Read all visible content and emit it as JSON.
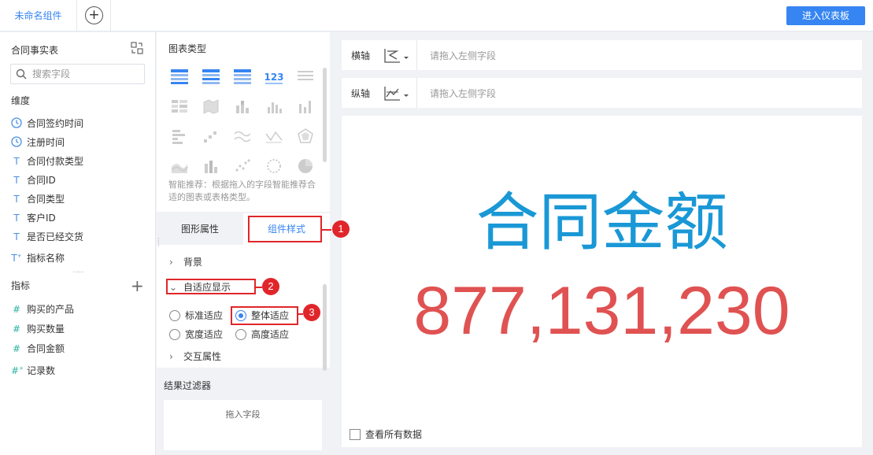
{
  "topbar": {
    "tab_label": "未命名组件",
    "add_tab_symbol": "+",
    "enter_dashboard_label": "进入仪表板"
  },
  "left_panel": {
    "title": "合同事实表",
    "search_placeholder": "搜索字段",
    "dimensions_label": "维度",
    "dimensions": [
      {
        "icon": "clock-icon",
        "type": "time",
        "label": "合同签约时间"
      },
      {
        "icon": "clock-icon",
        "type": "time",
        "label": "注册时间"
      },
      {
        "icon": "text-type-icon",
        "type": "text",
        "label": "合同付款类型"
      },
      {
        "icon": "text-type-icon",
        "type": "text",
        "label": "合同ID"
      },
      {
        "icon": "text-type-icon",
        "type": "text",
        "label": "合同类型"
      },
      {
        "icon": "text-type-icon",
        "type": "text",
        "label": "客户ID"
      },
      {
        "icon": "text-type-icon",
        "type": "text",
        "label": "是否已经交货"
      },
      {
        "icon": "text-type-icon",
        "type": "text-calc",
        "label": "指标名称"
      }
    ],
    "metrics_label": "指标",
    "metrics": [
      {
        "icon": "hash-icon",
        "label": "购买的产品"
      },
      {
        "icon": "hash-icon",
        "label": "购买数量"
      },
      {
        "icon": "hash-icon",
        "label": "合同金额"
      },
      {
        "icon": "hash-icon",
        "label": "记录数"
      }
    ]
  },
  "middle_panel": {
    "chart_type_title": "图表类型",
    "chart_type_hint": "智能推荐：根据拖入的字段智能推荐合适的图表或表格类型。",
    "tab_graph_props": "图形属性",
    "tab_component_style": "组件样式",
    "style_sections": {
      "background": "背景",
      "adaptive_display": "自适应显示",
      "interaction": "交互属性"
    },
    "adaptive_options": [
      {
        "label": "标准适应",
        "checked": false
      },
      {
        "label": "整体适应",
        "checked": true
      },
      {
        "label": "宽度适应",
        "checked": false
      },
      {
        "label": "高度适应",
        "checked": false
      }
    ],
    "result_filter_title": "结果过滤器",
    "drop_field_label": "拖入字段"
  },
  "axes": {
    "x_label": "横轴",
    "y_label": "纵轴",
    "x_placeholder": "请拖入左侧字段",
    "y_placeholder": "请拖入左侧字段"
  },
  "canvas": {
    "kpi_label": "合同金额",
    "kpi_value": "877,131,230",
    "kpi_label_color": "#1a98d6",
    "kpi_value_color": "#e05252",
    "see_all_data_label": "查看所有数据",
    "see_all_checked": false
  },
  "annotations": [
    "1",
    "2",
    "3"
  ],
  "colors": {
    "accent": "#3685f2",
    "annotation_red": "#e0262a"
  }
}
